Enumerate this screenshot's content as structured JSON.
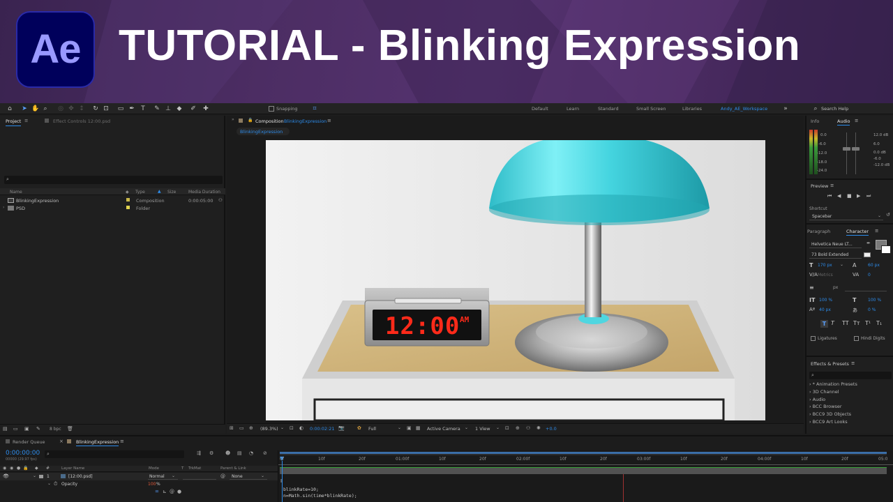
{
  "banner": {
    "logo_text": "Ae",
    "title": "TUTORIAL - Blinking Expression"
  },
  "toolbar": {
    "snapping_label": "Snapping",
    "workspaces": [
      "Default",
      "Learn",
      "Standard",
      "Small Screen",
      "Libraries",
      "Andy_AE_Workspace"
    ],
    "active_workspace": "Andy_AE_Workspace",
    "search_help": "Search Help"
  },
  "project": {
    "tab_label": "Project",
    "effect_controls_tab": "Effect Controls 12:00.psd",
    "search_placeholder": "",
    "columns": {
      "name": "Name",
      "type": "Type",
      "size": "Size",
      "duration": "Media Duration"
    },
    "rows": [
      {
        "name": "BlinkingExpression",
        "type": "Composition",
        "size": "",
        "duration": "0:00:05:00"
      },
      {
        "name": "PSD",
        "type": "Folder",
        "size": "",
        "duration": ""
      }
    ],
    "bpc": "8 bpc"
  },
  "composition": {
    "panel_label": "Composition",
    "comp_name": "BlinkingExpression",
    "sub_tab": "BlinkingExpression",
    "clock_time": "12:00",
    "clock_ampm": "AM",
    "zoom": "(89.3%)",
    "timecode": "0:00:02:21",
    "resolution": "Full",
    "camera": "Active Camera",
    "views": "1 View",
    "exposure": "+0.0"
  },
  "info_panel": {
    "info_tab": "Info",
    "audio_tab": "Audio",
    "left_db": [
      "0.0",
      "-6.0",
      "-12.0",
      "-18.0",
      "-24.0"
    ],
    "right_db": [
      "12.0 dB",
      "6.0",
      "0.0 dB",
      "-6.0",
      "-12.0 dB"
    ]
  },
  "preview_panel": {
    "tab": "Preview",
    "shortcut_label": "Shortcut",
    "shortcut_value": "Spacebar"
  },
  "character_panel": {
    "paragraph_tab": "Paragraph",
    "character_tab": "Character",
    "font": "Helvetica Neue LT...",
    "style": "73 Bold Extended",
    "size": "170 px",
    "leading": "60 px",
    "kerning": "Metrics",
    "tracking": "0",
    "stroke": "px",
    "vscale": "100 %",
    "hscale": "100 %",
    "baseline": "40 px",
    "tsume": "0 %",
    "ligatures": "Ligatures",
    "hindi_digits": "Hindi Digits"
  },
  "effects_panel": {
    "tab": "Effects & Presets",
    "items": [
      "* Animation Presets",
      "3D Channel",
      "Audio",
      "BCC Browser",
      "BCC9 3D Objects",
      "BCC9 Art Looks"
    ]
  },
  "timeline": {
    "render_queue_tab": "Render Queue",
    "comp_tab": "BlinkingExpression",
    "timecode": "0:00:00:00",
    "fps": "00000 (29.97 fps)",
    "columns": {
      "layer_name": "Layer Name",
      "mode": "Mode",
      "t": "T",
      "trkmat": "TrkMat",
      "parent": "Parent & Link"
    },
    "layer": {
      "index": "1",
      "name": "[12:00.psd]",
      "mode": "Normal",
      "parent": "None"
    },
    "property": {
      "name": "Opacity",
      "value": "100",
      "unit": "%"
    },
    "ruler": [
      "0f",
      "10f",
      "20f",
      "01:00f",
      "10f",
      "20f",
      "02:00f",
      "10f",
      "20f",
      "03:00f",
      "10f",
      "20f",
      "04:00f",
      "10f",
      "20f",
      "05:0"
    ],
    "code_lines": [
      "blinkRate=10;",
      "n=Math.sin(time*blinkRate);"
    ]
  },
  "colors": {
    "accent_blue": "#2d8ceb",
    "lamp_teal": "#4fd6e0",
    "clock_red": "#ff2a1a",
    "banner_purple": "#4c2d63"
  }
}
